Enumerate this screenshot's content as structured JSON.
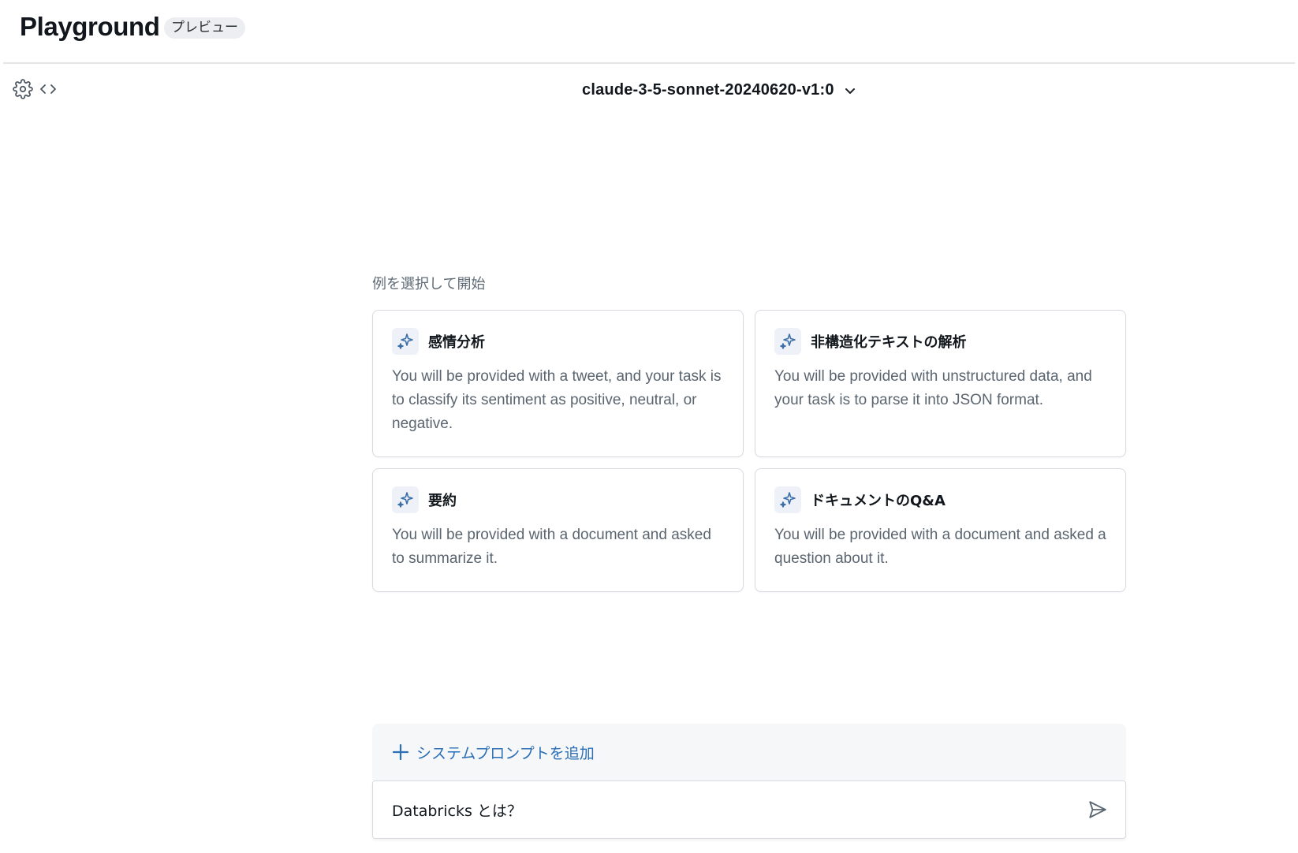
{
  "header": {
    "title": "Playground",
    "badge": "プレビュー"
  },
  "toolbar": {
    "settings_icon": "gear-icon",
    "code_icon": "code-brackets-icon"
  },
  "model_selector": {
    "value": "claude-3-5-sonnet-20240620-v1:0",
    "icon": "chevron-down-icon"
  },
  "examples": {
    "label": "例を選択して開始",
    "cards": [
      {
        "title": "感情分析",
        "description": "You will be provided with a tweet, and your task is to classify its sentiment as positive, neutral, or negative.",
        "icon": "sparkle-icon"
      },
      {
        "title": "非構造化テキストの解析",
        "description": "You will be provided with unstructured data, and your task is to parse it into JSON format.",
        "icon": "sparkle-icon"
      },
      {
        "title": "要約",
        "description": "You will be provided with a document and asked to summarize it.",
        "icon": "sparkle-icon"
      },
      {
        "title": "ドキュメントのQ&A",
        "description": "You will be provided with a document and asked a question about it.",
        "icon": "sparkle-icon"
      }
    ]
  },
  "system_prompt": {
    "label": "システムプロンプトを追加",
    "icon": "plus-icon"
  },
  "chat_input": {
    "value": "Databricks とは？",
    "send_icon": "send-icon"
  },
  "colors": {
    "accent": "#2c6fb7",
    "sparkle": "#3c6fa8",
    "text_muted": "#5a6570"
  }
}
